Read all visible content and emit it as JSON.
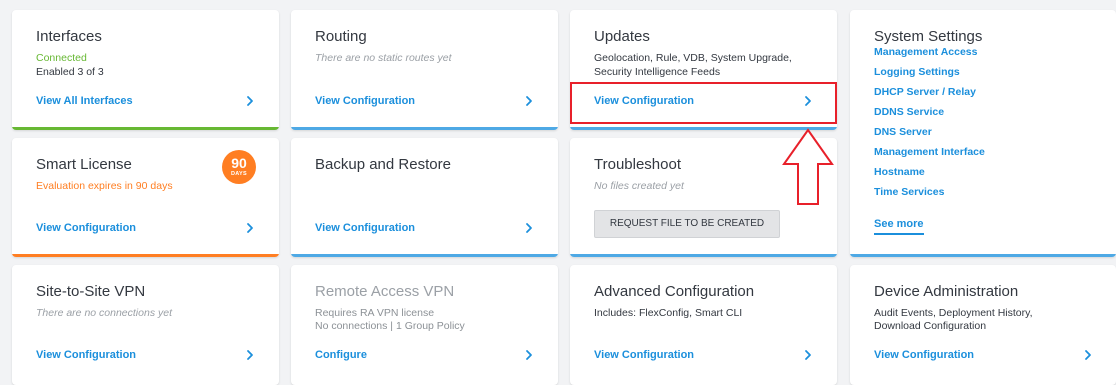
{
  "colors": {
    "link": "#1b8fdc",
    "green_bar": "#67b833",
    "orange_bar": "#ff7e22",
    "blue_bar": "#4ea9e5",
    "highlight": "#e8202a"
  },
  "cards": {
    "interfaces": {
      "title": "Interfaces",
      "status": "Connected",
      "enabled": "Enabled 3 of 3",
      "link": "View All Interfaces"
    },
    "routing": {
      "title": "Routing",
      "note": "There are no static routes yet",
      "link": "View Configuration"
    },
    "updates": {
      "title": "Updates",
      "desc_line1": "Geolocation, Rule, VDB, System Upgrade,",
      "desc_line2": "Security Intelligence Feeds",
      "link": "View Configuration"
    },
    "system_settings": {
      "title": "System Settings",
      "items": [
        "Management Access",
        "Logging Settings",
        "DHCP Server / Relay",
        "DDNS Service",
        "DNS Server",
        "Management Interface",
        "Hostname",
        "Time Services"
      ],
      "see_more": "See more"
    },
    "smart_license": {
      "title": "Smart License",
      "note": "Evaluation expires in 90 days",
      "badge_number": "90",
      "badge_unit": "DAYS",
      "link": "View Configuration"
    },
    "backup_restore": {
      "title": "Backup and Restore",
      "link": "View Configuration"
    },
    "troubleshoot": {
      "title": "Troubleshoot",
      "note": "No files created yet",
      "button": "REQUEST FILE TO BE CREATED"
    },
    "site_to_site": {
      "title": "Site-to-Site VPN",
      "note": "There are no connections yet",
      "link": "View Configuration"
    },
    "remote_access": {
      "title": "Remote Access VPN",
      "line1": "Requires RA VPN license",
      "line2": "No connections | 1 Group Policy",
      "link": "Configure"
    },
    "advanced": {
      "title": "Advanced Configuration",
      "desc": "Includes: FlexConfig, Smart CLI",
      "link": "View Configuration"
    },
    "device_admin": {
      "title": "Device Administration",
      "desc_line1": "Audit Events, Deployment History,",
      "desc_line2": "Download Configuration",
      "link": "View Configuration"
    }
  }
}
